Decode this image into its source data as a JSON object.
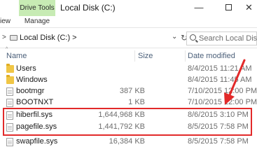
{
  "titlebar": {
    "contextual_tab": "Drive Tools",
    "title": "Local Disk (C:)",
    "minimize_glyph": "—",
    "close_glyph": "✕"
  },
  "ribbon": {
    "view_tab": "iew",
    "manage_tab": "Manage"
  },
  "address": {
    "path": "Local Disk (C:)  >",
    "search_placeholder": "Search Local Disk ..."
  },
  "columns": {
    "name": "Name",
    "size": "Size",
    "date": "Date modified"
  },
  "files": [
    {
      "name": "Users",
      "size": "",
      "date": "8/4/2015 11:21 AM",
      "type": "folder"
    },
    {
      "name": "Windows",
      "size": "",
      "date": "8/4/2015 11:45 AM",
      "type": "folder"
    },
    {
      "name": "bootmgr",
      "size": "387 KB",
      "date": "7/10/2015 12:00 PM",
      "type": "file"
    },
    {
      "name": "BOOTNXT",
      "size": "1 KB",
      "date": "7/10/2015 12:00 PM",
      "type": "file"
    },
    {
      "name": "hiberfil.sys",
      "size": "1,644,968 KB",
      "date": "8/6/2015 3:10 PM",
      "type": "file"
    },
    {
      "name": "pagefile.sys",
      "size": "1,441,792 KB",
      "date": "8/5/2015 7:58 PM",
      "type": "file"
    },
    {
      "name": "swapfile.sys",
      "size": "16,384 KB",
      "date": "8/5/2015 7:58 PM",
      "type": "file"
    }
  ],
  "colors": {
    "contextual_tab_bg": "#c7ebb4",
    "highlight": "#e22a2a",
    "header_text": "#4c607a"
  }
}
